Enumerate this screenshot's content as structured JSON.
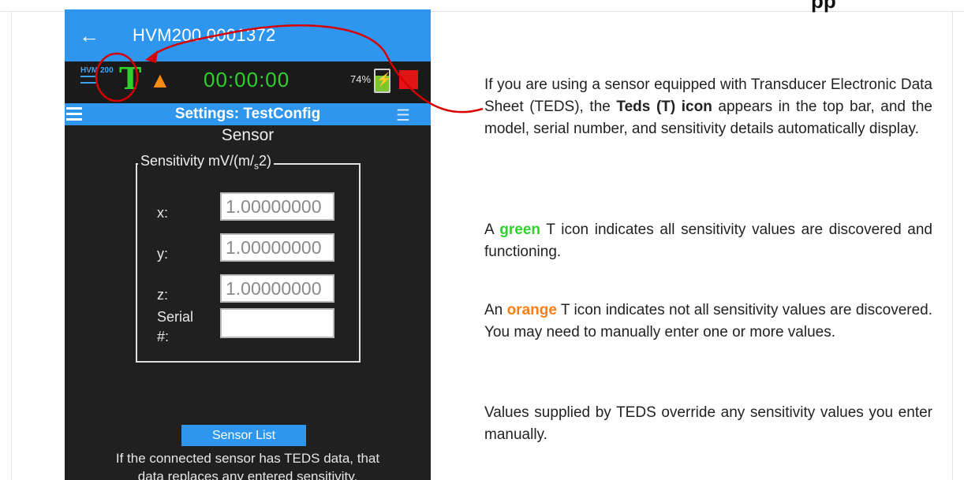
{
  "page_header_fragment": "pp",
  "phone": {
    "app_title": "HVM200 0001372",
    "logo_text": "HVM 200",
    "teds_icon_label": "T",
    "timer": "00:00:00",
    "battery_percent": "74%",
    "settings_title": "Settings: TestConfig",
    "section_title": "Sensor",
    "sensitivity_legend": "Sensitivity mV/(m/s2)",
    "fields": [
      {
        "label": "x:",
        "value": "1.00000000"
      },
      {
        "label": "y:",
        "value": "1.00000000"
      },
      {
        "label": "z:",
        "value": "1.00000000"
      }
    ],
    "serial_label_line1": "Serial",
    "serial_label_line2": "#:",
    "serial_value": "",
    "sensor_list_button": "Sensor List",
    "note_line1": "If the connected sensor has TEDS data, that",
    "note_line2": "data replaces any entered sensitivity.",
    "colors": {
      "accent": "#2f96f0",
      "teds_green": "#2fd12f",
      "warning_orange": "#ff8c12",
      "record_red": "#e01414",
      "background": "#202020"
    }
  },
  "doc": {
    "p1_a": "If you are using a sensor equipped with Transducer Electronic Data Sheet (TEDS), the ",
    "p1_bold": "Teds (T) icon",
    "p1_b": " appears in the top bar, and the model, serial number, and sensitivity details automatically display.",
    "p2_a": "A ",
    "p2_green": "green",
    "p2_b": " T icon indicates all sensitivity values are discovered and functioning.",
    "p3_a": "An ",
    "p3_orange": "orange",
    "p3_b": " T icon indicates not all sensitivity values are discovered. You may need to manually enter one or more values.",
    "p4": "Values supplied by TEDS override any sensitivity values you enter manually."
  }
}
